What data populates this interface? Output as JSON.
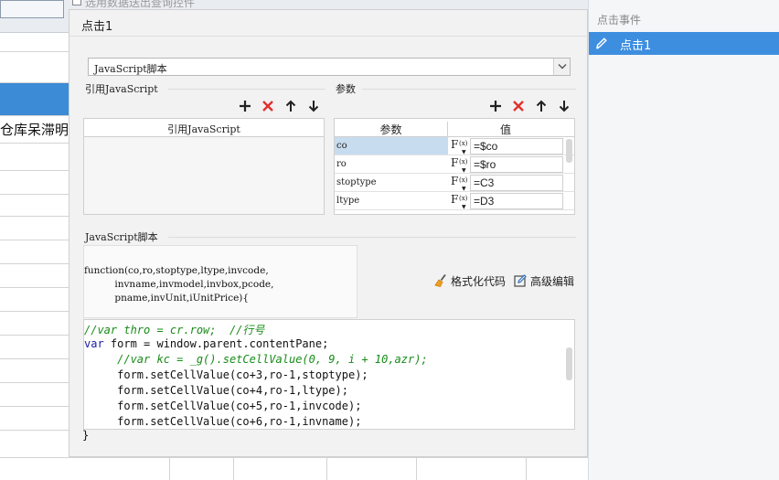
{
  "background": {
    "checkbox_text": "选用数据送出查询控件",
    "cell_text": "仓库呆滞明"
  },
  "right_panel": {
    "title": "点击事件",
    "item_label": "点击1"
  },
  "dialog": {
    "title": "点击1",
    "script_type": "JavaScript脚本",
    "ref_section_label": "引用JavaScript",
    "ref_table_header": "引用JavaScript",
    "params_section_label": "参数",
    "params_headers": [
      "参数",
      "值"
    ],
    "params": [
      {
        "name": "co",
        "value": "=$co"
      },
      {
        "name": "ro",
        "value": "=$ro"
      },
      {
        "name": "stoptype",
        "value": "=C3"
      },
      {
        "name": "ltype",
        "value": "=D3"
      }
    ],
    "script_section_label": "JavaScript脚本",
    "function_signature": "function(co,ro,stoptype,ltype,invcode,\n          invname,invmodel,invbox,pcode,\n          pname,invUnit,iUnitPrice){",
    "format_code_label": "格式化代码",
    "advanced_edit_label": "高级编辑",
    "code_lines": [
      "//var thro = cr.row;  //行号",
      "var form = window.parent.contentPane;",
      "     //var kc = _g().setCellValue(0, 9, i + 10,azr);",
      "     form.setCellValue(co+3,ro-1,stoptype);",
      "     form.setCellValue(co+4,ro-1,ltype);",
      "     form.setCellValue(co+5,ro-1,invcode);",
      "     form.setCellValue(co+6,ro-1,invname);"
    ],
    "closing_brace": "}"
  },
  "colors": {
    "accent": "#3e8ee0",
    "delete_red": "#e0322d",
    "comment_green": "#178b17",
    "keyword_blue": "#1a1aa6"
  }
}
